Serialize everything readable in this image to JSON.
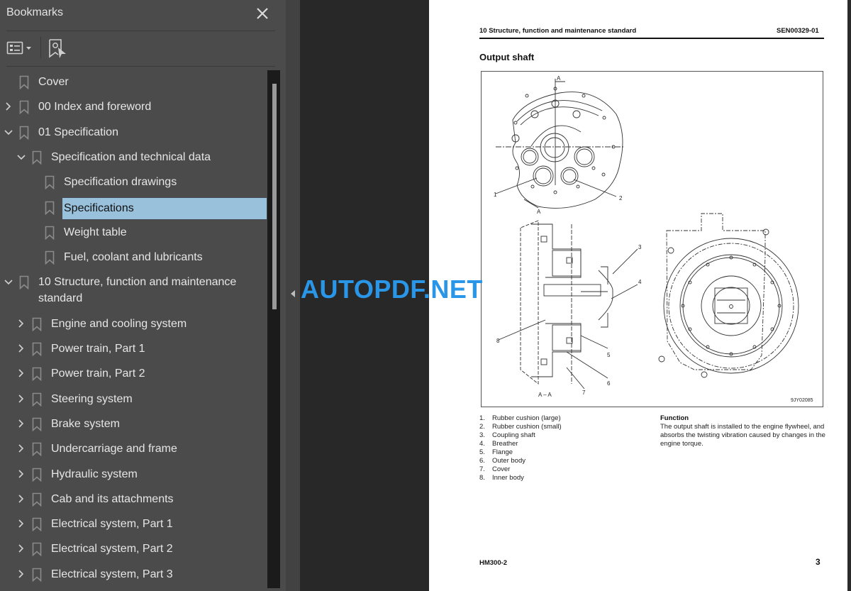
{
  "panel": {
    "title": "Bookmarks",
    "close_icon": "close-icon",
    "options_icon": "list-options-icon",
    "find_bookmark_icon": "find-current-bookmark-icon"
  },
  "bookmarks": [
    {
      "label": "Cover",
      "level": 0,
      "expander": "none"
    },
    {
      "label": "00 Index and foreword",
      "level": 0,
      "expander": "collapsed"
    },
    {
      "label": "01 Specification",
      "level": 0,
      "expander": "expanded"
    },
    {
      "label": "Specification and technical data",
      "level": 1,
      "expander": "expanded"
    },
    {
      "label": "Specification drawings",
      "level": 2,
      "expander": "none"
    },
    {
      "label": "Specifications",
      "level": 2,
      "expander": "none",
      "selected": true
    },
    {
      "label": "Weight table",
      "level": 2,
      "expander": "none"
    },
    {
      "label": "Fuel, coolant and lubricants",
      "level": 2,
      "expander": "none"
    },
    {
      "label": "10 Structure, function and maintenance",
      "label2": "standard",
      "level": 0,
      "expander": "expanded"
    },
    {
      "label": "Engine and cooling system",
      "level": 1,
      "expander": "collapsed"
    },
    {
      "label": "Power train, Part 1",
      "level": 1,
      "expander": "collapsed"
    },
    {
      "label": "Power train, Part 2",
      "level": 1,
      "expander": "collapsed"
    },
    {
      "label": "Steering system",
      "level": 1,
      "expander": "collapsed"
    },
    {
      "label": "Brake system",
      "level": 1,
      "expander": "collapsed"
    },
    {
      "label": "Undercarriage and frame",
      "level": 1,
      "expander": "collapsed"
    },
    {
      "label": "Hydraulic system",
      "level": 1,
      "expander": "collapsed"
    },
    {
      "label": "Cab and its attachments",
      "level": 1,
      "expander": "collapsed"
    },
    {
      "label": "Electrical system, Part 1",
      "level": 1,
      "expander": "collapsed"
    },
    {
      "label": "Electrical system, Part 2",
      "level": 1,
      "expander": "collapsed"
    },
    {
      "label": "Electrical system, Part 3",
      "level": 1,
      "expander": "collapsed"
    }
  ],
  "watermark": "AUTOPDF.NET",
  "colors": {
    "panel_bg": "#4b4b4b",
    "viewer_bg": "#282828",
    "selection": "#99c1dc",
    "watermark": "#2a96e8"
  },
  "document": {
    "header_left": "10 Structure, function and maintenance standard",
    "header_right": "SEN00329-01",
    "section_title": "Output shaft",
    "figure": {
      "section_mark": "A",
      "section_label": "A – A",
      "figure_id": "9JY02085",
      "callouts": [
        "1",
        "2",
        "3",
        "4",
        "5",
        "6",
        "7",
        "8"
      ]
    },
    "parts": [
      {
        "num": "1.",
        "name": "Rubber cushion (large)"
      },
      {
        "num": "2.",
        "name": "Rubber cushion (small)"
      },
      {
        "num": "3.",
        "name": "Coupling shaft"
      },
      {
        "num": "4.",
        "name": "Breather"
      },
      {
        "num": "5.",
        "name": "Flange"
      },
      {
        "num": "6.",
        "name": "Outer body"
      },
      {
        "num": "7.",
        "name": "Cover"
      },
      {
        "num": "8.",
        "name": "Inner body"
      }
    ],
    "function_title": "Function",
    "function_text": "The output shaft is installed to the engine flywheel, and absorbs the twisting vibration caused by changes in the engine torque.",
    "footer_left": "HM300-2",
    "page_number": "3"
  }
}
